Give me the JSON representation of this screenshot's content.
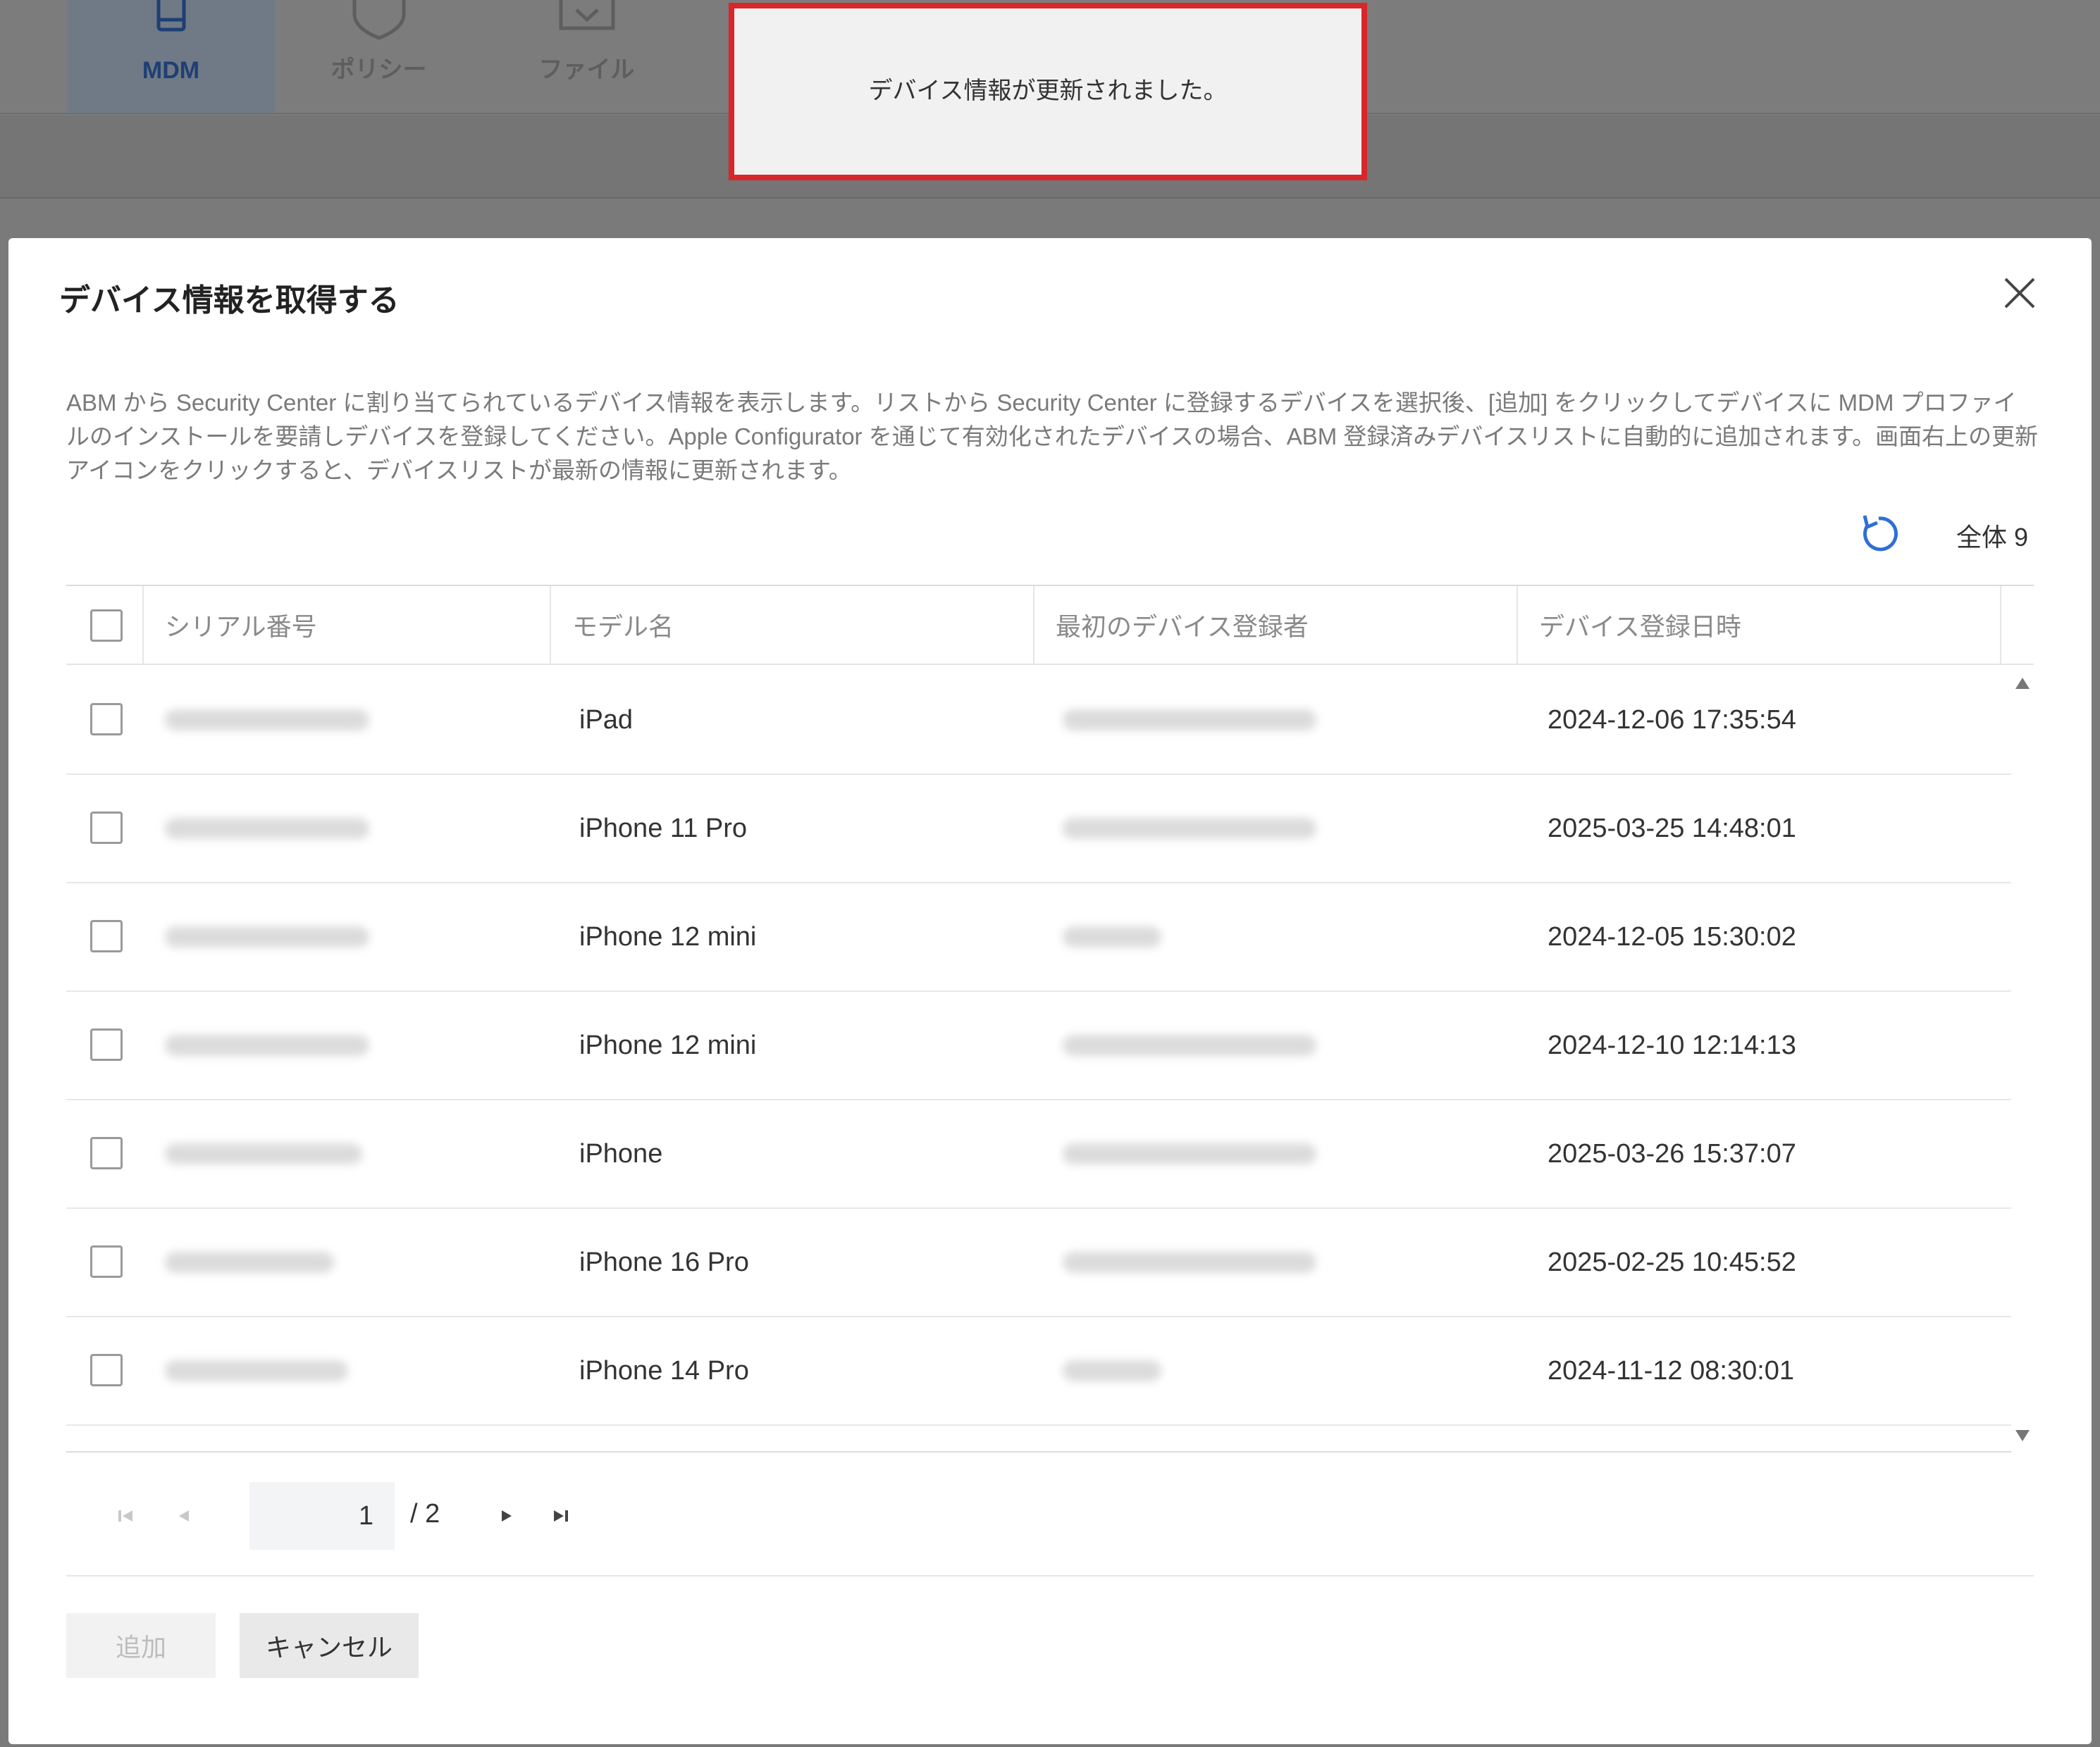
{
  "nav": {
    "items": [
      {
        "label": "MDM",
        "active": true,
        "icon": "device-icon"
      },
      {
        "label": "ポリシー",
        "active": false,
        "icon": "shield-icon"
      },
      {
        "label": "ファイル",
        "active": false,
        "icon": "download-box-icon"
      }
    ]
  },
  "toast": {
    "message": "デバイス情報が更新されました。",
    "border_color": "#d9262b"
  },
  "modal": {
    "title": "デバイス情報を取得する",
    "description": "ABM から Security Center に割り当てられているデバイス情報を表示します。リストから Security Center に登録するデバイスを選択後、[追加] をクリックしてデバイスに MDM プロファイルのインストールを要請しデバイスを登録してください。Apple Configurator を通じて有効化されたデバイスの場合、ABM 登録済みデバイスリストに自動的に追加されます。画面右上の更新アイコンをクリックすると、デバイスリストが最新の情報に更新されます。",
    "total_label": "全体 9",
    "refresh_icon": "refresh-icon",
    "accent_color": "#2f6fd6"
  },
  "table": {
    "columns": [
      "シリアル番号",
      "モデル名",
      "最初のデバイス登録者",
      "デバイス登録日時"
    ],
    "rows": [
      {
        "model": "iPad",
        "datetime": "2024-12-06 17:35:54"
      },
      {
        "model": "iPhone 11 Pro",
        "datetime": "2025-03-25 14:48:01"
      },
      {
        "model": "iPhone 12 mini",
        "datetime": "2024-12-05 15:30:02"
      },
      {
        "model": "iPhone 12 mini",
        "datetime": "2024-12-10 12:14:13"
      },
      {
        "model": "iPhone",
        "datetime": "2025-03-26 15:37:07"
      },
      {
        "model": "iPhone 16 Pro",
        "datetime": "2025-02-25 10:45:52"
      },
      {
        "model": "iPhone 14 Pro",
        "datetime": "2024-11-12 08:30:01"
      }
    ]
  },
  "pagination": {
    "current_page": "1",
    "total_pages": "/ 2"
  },
  "buttons": {
    "add": "追加",
    "cancel": "キャンセル"
  }
}
